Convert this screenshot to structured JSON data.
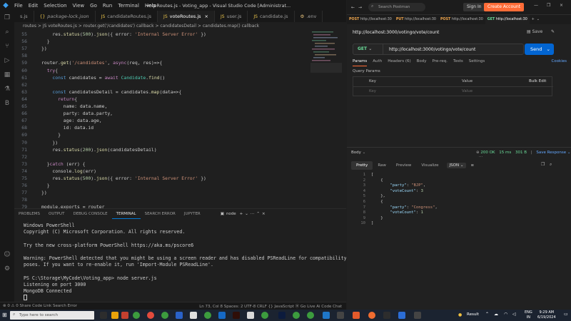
{
  "vscode": {
    "menu": [
      "File",
      "Edit",
      "Selection",
      "View",
      "Go",
      "Run",
      "Terminal",
      "Help"
    ],
    "window_title": "voteRoutes.js - Voting_app - Visual Studio Code [Administrat...",
    "tabs": [
      {
        "label": "s.js",
        "icon": "js"
      },
      {
        "label": "package-lock.json",
        "icon": "bracket"
      },
      {
        "label": "candidateRoutes.js",
        "icon": "js"
      },
      {
        "label": "voteRoutes.js",
        "icon": "js",
        "active": true
      },
      {
        "label": "user.js",
        "icon": "js"
      },
      {
        "label": "candidate.js",
        "icon": "js"
      },
      {
        "label": ".env",
        "icon": "gear"
      }
    ],
    "breadcrumb": "routes  >  JS voteRoutes.js  >  router.get('/candidates') callback  >  candidatesDetail  >  candidates.map() callback",
    "code_lines": [
      {
        "n": "55",
        "html": "    res.status(500).json({ error: 'Internal Server Error' })"
      },
      {
        "n": "56",
        "html": "  }"
      },
      {
        "n": "57",
        "html": "})"
      },
      {
        "n": "58",
        "html": ""
      },
      {
        "n": "59",
        "html": "router.get('/candidates', async(req, res)=>{"
      },
      {
        "n": "60",
        "html": "  try{"
      },
      {
        "n": "61",
        "html": "    const candidates = await Candidate.find()"
      },
      {
        "n": "62",
        "html": ""
      },
      {
        "n": "63",
        "html": "    const candidatesDetail = candidates.map(data=>{"
      },
      {
        "n": "64",
        "html": "      return{"
      },
      {
        "n": "65",
        "html": "        name: data.name,"
      },
      {
        "n": "66",
        "html": "        party: data.party,"
      },
      {
        "n": "67",
        "html": "        age: data.age,"
      },
      {
        "n": "68",
        "html": "        id: data.id"
      },
      {
        "n": "69",
        "html": "      }"
      },
      {
        "n": "70",
        "html": "    })"
      },
      {
        "n": "71",
        "html": "    res.status(200).json(candidatesDetail)"
      },
      {
        "n": "72",
        "html": ""
      },
      {
        "n": "73",
        "html": "  }catch (err) {"
      },
      {
        "n": "74",
        "html": "    console.log(err)"
      },
      {
        "n": "75",
        "html": "    res.status(500).json({ error: 'Internal Server Error' })"
      },
      {
        "n": "76",
        "html": "  }"
      },
      {
        "n": "77",
        "html": "})"
      },
      {
        "n": "78",
        "html": ""
      },
      {
        "n": "79",
        "html": "module.exports = router"
      }
    ],
    "panel_tabs": [
      "PROBLEMS",
      "OUTPUT",
      "DEBUG CONSOLE",
      "TERMINAL",
      "SEARCH ERROR",
      "JUPYTER"
    ],
    "panel_active": "TERMINAL",
    "terminal_shell": "node",
    "terminal_lines": [
      "Windows PowerShell",
      "Copyright (C) Microsoft Corporation. All rights reserved.",
      "",
      "Try the new cross-platform PowerShell https://aka.ms/pscore6",
      "",
      "Warning: PowerShell detected that you might be using a screen reader and has disabled PSReadLine for compatibility pur",
      "poses. If you want to re-enable it, run 'Import-Module PSReadLine'.",
      "",
      "PS C:\\Storage\\MyCode\\Voting_app> node server.js",
      "Listening on port 3000",
      "MongoDB Connected"
    ],
    "status_left": "⊗ 0 ⚠ 0   Share Code Link   Search Error",
    "status_right": "Ln 73, Col 8   Spaces: 2   UTF-8   CRLF   {} JavaScript   ⦿ Go Live   Ai Code Chat"
  },
  "postman": {
    "search_placeholder": "Search Postman",
    "sign_in": "Sign In",
    "create_account": "Create Account",
    "request_tabs": [
      {
        "method": "POST",
        "label": "http://localhost:30"
      },
      {
        "method": "PUT",
        "label": "http://localhost:30"
      },
      {
        "method": "POST",
        "label": "http://localhost:30"
      },
      {
        "method": "GET",
        "label": "http://localhost:30"
      }
    ],
    "request_name": "http://localhost:3000/votingo/vote/count",
    "save_label": "Save",
    "method": "GET",
    "url": "http://localhost:3000/votingo/vote/count",
    "send_label": "Send",
    "sub_tabs": [
      "Params",
      "Auth",
      "Headers (6)",
      "Body",
      "Pre-req.",
      "Tests",
      "Settings"
    ],
    "cookies": "Cookies",
    "query_params": "Query Params",
    "table_headers": {
      "key": "Key",
      "value": "Value",
      "bulk": "Bulk Edit"
    },
    "table_placeholder": {
      "key": "Key",
      "value": "Value"
    },
    "response": {
      "body_label": "Body",
      "status": "200 OK",
      "time": "15 ms",
      "size": "301 B",
      "save_response": "Save Response",
      "tabs": [
        "Pretty",
        "Raw",
        "Preview",
        "Visualize"
      ],
      "format": "JSON",
      "json_lines": [
        {
          "n": "1",
          "t": "["
        },
        {
          "n": "2",
          "t": "    {"
        },
        {
          "n": "3",
          "t": "        \"party\": \"BJP\","
        },
        {
          "n": "4",
          "t": "        \"voteCount\": 3"
        },
        {
          "n": "5",
          "t": "    },"
        },
        {
          "n": "6",
          "t": "    {"
        },
        {
          "n": "7",
          "t": "        \"party\": \"Congress\","
        },
        {
          "n": "8",
          "t": "        \"voteCount\": 1"
        },
        {
          "n": "9",
          "t": "    }"
        },
        {
          "n": "10",
          "t": "]"
        }
      ]
    }
  },
  "taskbar": {
    "search_placeholder": "Type here to search",
    "result": "Result",
    "lang": "ENG",
    "region": "IN",
    "time": "9:29 AM",
    "date": "6/19/2024"
  },
  "colors": {
    "accent": "#0078d4",
    "postman_orange": "#ff6c37",
    "send_blue": "#0265d2",
    "get_green": "#6bdd9a"
  }
}
